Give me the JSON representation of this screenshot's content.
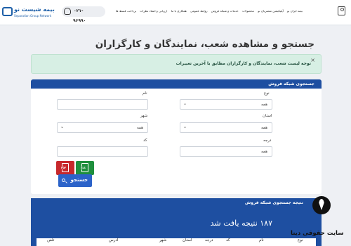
{
  "header": {
    "logo": {
      "name": "بیمه شیست نو",
      "tagline": "Separation Group Network"
    },
    "phone": {
      "text": "۰۲۱-",
      "overflow": "۹۶۹۹۰"
    },
    "nav": [
      "بیمه ایران نو",
      "آپلیکیشن مشتریان نو",
      "محصولات",
      "خدمات و شبکه فروش",
      "روابط عمومی",
      "همکاری با ما",
      "ارزیابی و انتقاد نظرات",
      "پرداخت قسط ها"
    ]
  },
  "page": {
    "title": "جستجو و مشاهده شعب، نمایندگان و کارگزاران"
  },
  "alert": {
    "text": "توجه لیست شعب، نمایندگان و کارگزاران مطابق با آخرین تغییرات",
    "close": "×"
  },
  "search": {
    "panel_title": "جستجوی شبکه فروش",
    "type_label": "نوع",
    "type_value": "همه",
    "name_label": "نام",
    "name_value": "",
    "province_label": "استان",
    "province_value": "همه",
    "city_label": "شهر",
    "city_value": "همه",
    "grade_label": "درجه",
    "grade_value": "همه",
    "code_label": "کد",
    "code_value": "",
    "pdf_tag": "PDF",
    "xls_tag": "XLS",
    "button_label": "جستجو"
  },
  "results": {
    "title": "نتیجه جستجوی شبکه فروش",
    "count_text": "۱۸۷ نتیجه یافت شد",
    "columns": [
      "نوع",
      "نام",
      "کد",
      "درجه",
      "استان",
      "شهر",
      "آدرس",
      "تلفن"
    ]
  },
  "watermark": {
    "text": "سایت حقوقی دینا"
  },
  "colors": {
    "primary": "#1e4fa1",
    "search_button": "#2c63c9",
    "alert_bg": "#d7efe4",
    "pdf": "#c7282c",
    "excel": "#1f8f3d"
  }
}
